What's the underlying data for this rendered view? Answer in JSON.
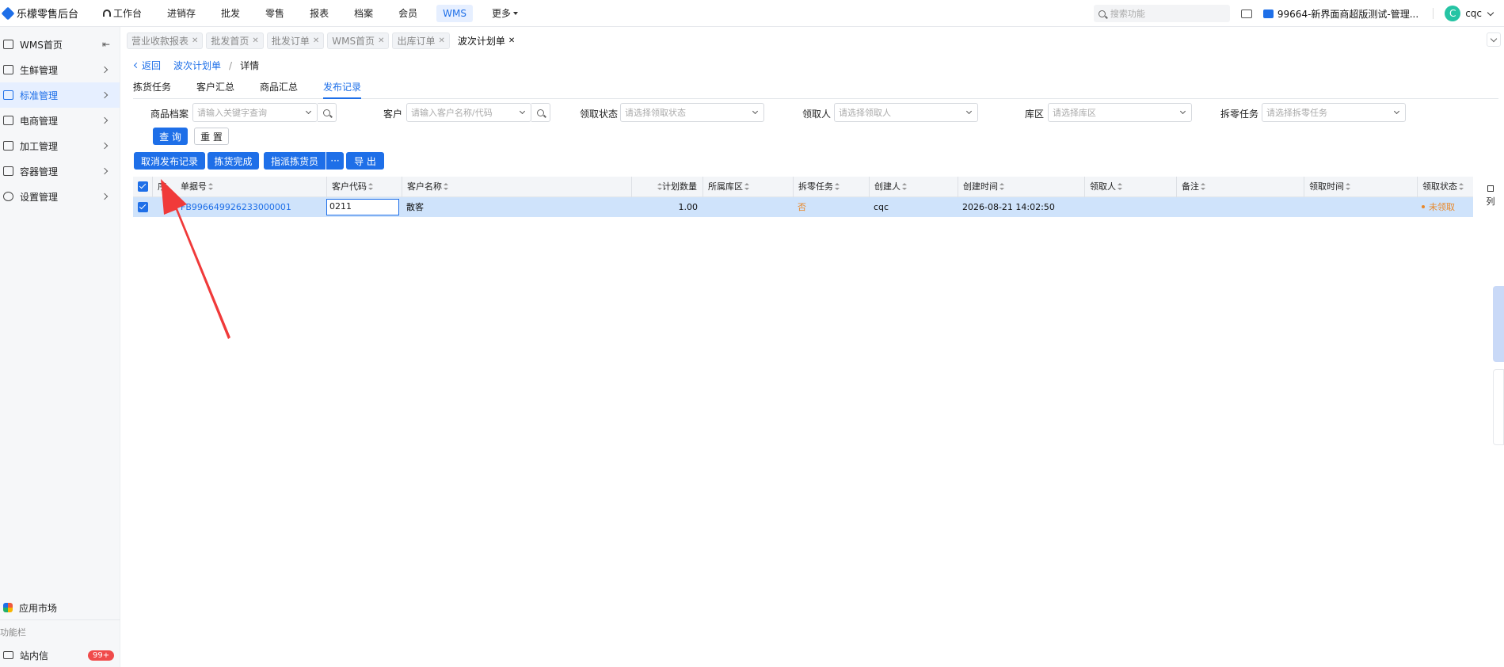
{
  "brand": {
    "name": "乐檬零售后台"
  },
  "topnav": {
    "items": [
      "工作台",
      "进销存",
      "批发",
      "零售",
      "报表",
      "档案",
      "会员",
      "WMS",
      "更多"
    ],
    "search_placeholder": "搜索功能",
    "store_name": "99664-新界面商超版测试-管理...",
    "avatar_letter": "C",
    "user": "cqc"
  },
  "sidebar": {
    "items": [
      "WMS首页",
      "生鲜管理",
      "标准管理",
      "电商管理",
      "加工管理",
      "容器管理",
      "设置管理"
    ],
    "app_market": "应用市场",
    "func_bar": "功能栏",
    "messages": "站内信",
    "badge": "99+"
  },
  "tabs": [
    "营业收款报表",
    "批发首页",
    "批发订单",
    "WMS首页",
    "出库订单",
    "波次计划单"
  ],
  "breadcrumb": {
    "back": "返回",
    "link": "波次计划单",
    "sep": "/",
    "current": "详情"
  },
  "subtabs": [
    "拣货任务",
    "客户汇总",
    "商品汇总",
    "发布记录"
  ],
  "filters": {
    "product_label": "商品档案",
    "product_placeholder": "请输入关键字查询",
    "customer_label": "客户",
    "customer_placeholder": "请输入客户名称/代码",
    "status_label": "领取状态",
    "status_placeholder": "请选择领取状态",
    "receiver_label": "领取人",
    "receiver_placeholder": "请选择领取人",
    "zone_label": "库区",
    "zone_placeholder": "请选择库区",
    "split_label": "拆零任务",
    "split_placeholder": "请选择拆零任务"
  },
  "buttons": {
    "query": "查 询",
    "reset": "重 置",
    "cancel_publish": "取消发布记录",
    "pick_done": "拣货完成",
    "assign_picker": "指派拣货员",
    "more": "···",
    "export": "导 出"
  },
  "table": {
    "headers": [
      "序",
      "单据号",
      "客户代码",
      "客户名称",
      "计划数量",
      "所属库区",
      "拆零任务",
      "创建人",
      "创建时间",
      "领取人",
      "备注",
      "领取时间",
      "领取状态"
    ],
    "rows": [
      {
        "order_no": "FB996649926233000001",
        "customer_code": "0211",
        "customer_name": "散客",
        "qty": "1.00",
        "zone": "",
        "split": "否",
        "creator": "cqc",
        "created_at": "2026-08-21 14:02:50",
        "receiver": "",
        "remark": "",
        "received_at": "",
        "status": "未领取"
      }
    ]
  },
  "right_edge": {
    "column_toggle": "列"
  },
  "colors": {
    "accent": "#1e6fe8",
    "row_selected": "#cfe3fb",
    "warning": "#e8882a",
    "annotation": "#f03a3a"
  }
}
